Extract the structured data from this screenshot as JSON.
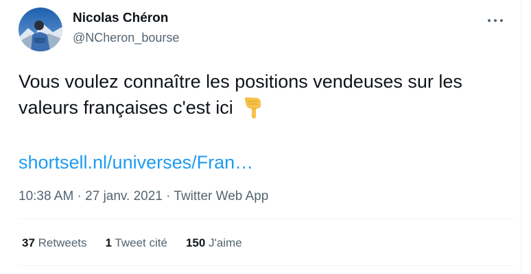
{
  "author": {
    "display_name": "Nicolas Chéron",
    "handle": "@NCheron_bourse"
  },
  "tweet": {
    "text": "Vous voulez connaître les positions vendeuses sur les valeurs françaises c'est ici",
    "emoji": "backhand-index-pointing-down",
    "link": "shortsell.nl/universes/Fran…",
    "meta": "10:38 AM · 27 janv. 2021 · Twitter Web App"
  },
  "stats": {
    "retweets_count": "37",
    "retweets_label": "Retweets",
    "quotes_count": "1",
    "quotes_label": "Tweet cité",
    "likes_count": "150",
    "likes_label": "J'aime"
  },
  "colors": {
    "link": "#1d9bf0",
    "secondary_text": "#536471",
    "divider": "#eff3f4"
  }
}
